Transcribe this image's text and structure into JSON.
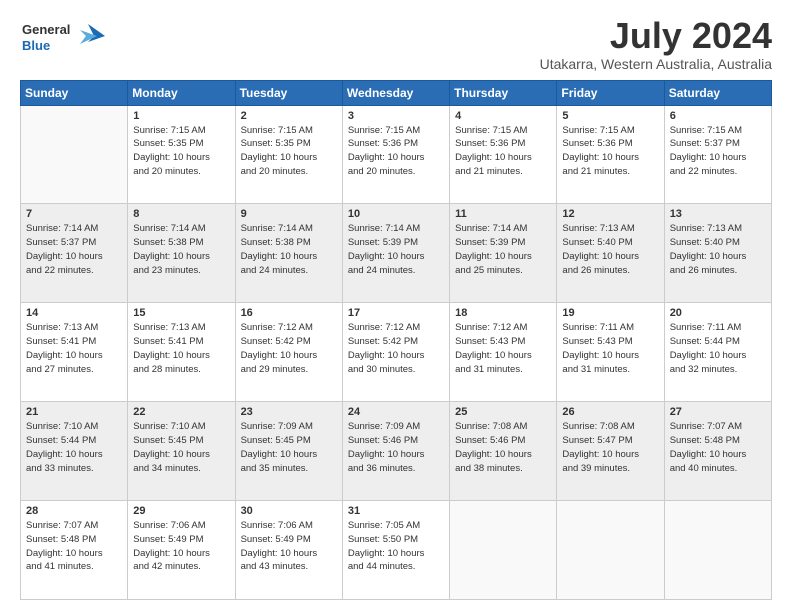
{
  "header": {
    "logo_line1": "General",
    "logo_line2": "Blue",
    "month": "July 2024",
    "location": "Utakarra, Western Australia, Australia"
  },
  "days_of_week": [
    "Sunday",
    "Monday",
    "Tuesday",
    "Wednesday",
    "Thursday",
    "Friday",
    "Saturday"
  ],
  "weeks": [
    [
      {
        "day": "",
        "content": ""
      },
      {
        "day": "1",
        "content": "Sunrise: 7:15 AM\nSunset: 5:35 PM\nDaylight: 10 hours\nand 20 minutes."
      },
      {
        "day": "2",
        "content": "Sunrise: 7:15 AM\nSunset: 5:35 PM\nDaylight: 10 hours\nand 20 minutes."
      },
      {
        "day": "3",
        "content": "Sunrise: 7:15 AM\nSunset: 5:36 PM\nDaylight: 10 hours\nand 20 minutes."
      },
      {
        "day": "4",
        "content": "Sunrise: 7:15 AM\nSunset: 5:36 PM\nDaylight: 10 hours\nand 21 minutes."
      },
      {
        "day": "5",
        "content": "Sunrise: 7:15 AM\nSunset: 5:36 PM\nDaylight: 10 hours\nand 21 minutes."
      },
      {
        "day": "6",
        "content": "Sunrise: 7:15 AM\nSunset: 5:37 PM\nDaylight: 10 hours\nand 22 minutes."
      }
    ],
    [
      {
        "day": "7",
        "content": "Sunrise: 7:14 AM\nSunset: 5:37 PM\nDaylight: 10 hours\nand 22 minutes."
      },
      {
        "day": "8",
        "content": "Sunrise: 7:14 AM\nSunset: 5:38 PM\nDaylight: 10 hours\nand 23 minutes."
      },
      {
        "day": "9",
        "content": "Sunrise: 7:14 AM\nSunset: 5:38 PM\nDaylight: 10 hours\nand 24 minutes."
      },
      {
        "day": "10",
        "content": "Sunrise: 7:14 AM\nSunset: 5:39 PM\nDaylight: 10 hours\nand 24 minutes."
      },
      {
        "day": "11",
        "content": "Sunrise: 7:14 AM\nSunset: 5:39 PM\nDaylight: 10 hours\nand 25 minutes."
      },
      {
        "day": "12",
        "content": "Sunrise: 7:13 AM\nSunset: 5:40 PM\nDaylight: 10 hours\nand 26 minutes."
      },
      {
        "day": "13",
        "content": "Sunrise: 7:13 AM\nSunset: 5:40 PM\nDaylight: 10 hours\nand 26 minutes."
      }
    ],
    [
      {
        "day": "14",
        "content": "Sunrise: 7:13 AM\nSunset: 5:41 PM\nDaylight: 10 hours\nand 27 minutes."
      },
      {
        "day": "15",
        "content": "Sunrise: 7:13 AM\nSunset: 5:41 PM\nDaylight: 10 hours\nand 28 minutes."
      },
      {
        "day": "16",
        "content": "Sunrise: 7:12 AM\nSunset: 5:42 PM\nDaylight: 10 hours\nand 29 minutes."
      },
      {
        "day": "17",
        "content": "Sunrise: 7:12 AM\nSunset: 5:42 PM\nDaylight: 10 hours\nand 30 minutes."
      },
      {
        "day": "18",
        "content": "Sunrise: 7:12 AM\nSunset: 5:43 PM\nDaylight: 10 hours\nand 31 minutes."
      },
      {
        "day": "19",
        "content": "Sunrise: 7:11 AM\nSunset: 5:43 PM\nDaylight: 10 hours\nand 31 minutes."
      },
      {
        "day": "20",
        "content": "Sunrise: 7:11 AM\nSunset: 5:44 PM\nDaylight: 10 hours\nand 32 minutes."
      }
    ],
    [
      {
        "day": "21",
        "content": "Sunrise: 7:10 AM\nSunset: 5:44 PM\nDaylight: 10 hours\nand 33 minutes."
      },
      {
        "day": "22",
        "content": "Sunrise: 7:10 AM\nSunset: 5:45 PM\nDaylight: 10 hours\nand 34 minutes."
      },
      {
        "day": "23",
        "content": "Sunrise: 7:09 AM\nSunset: 5:45 PM\nDaylight: 10 hours\nand 35 minutes."
      },
      {
        "day": "24",
        "content": "Sunrise: 7:09 AM\nSunset: 5:46 PM\nDaylight: 10 hours\nand 36 minutes."
      },
      {
        "day": "25",
        "content": "Sunrise: 7:08 AM\nSunset: 5:46 PM\nDaylight: 10 hours\nand 38 minutes."
      },
      {
        "day": "26",
        "content": "Sunrise: 7:08 AM\nSunset: 5:47 PM\nDaylight: 10 hours\nand 39 minutes."
      },
      {
        "day": "27",
        "content": "Sunrise: 7:07 AM\nSunset: 5:48 PM\nDaylight: 10 hours\nand 40 minutes."
      }
    ],
    [
      {
        "day": "28",
        "content": "Sunrise: 7:07 AM\nSunset: 5:48 PM\nDaylight: 10 hours\nand 41 minutes."
      },
      {
        "day": "29",
        "content": "Sunrise: 7:06 AM\nSunset: 5:49 PM\nDaylight: 10 hours\nand 42 minutes."
      },
      {
        "day": "30",
        "content": "Sunrise: 7:06 AM\nSunset: 5:49 PM\nDaylight: 10 hours\nand 43 minutes."
      },
      {
        "day": "31",
        "content": "Sunrise: 7:05 AM\nSunset: 5:50 PM\nDaylight: 10 hours\nand 44 minutes."
      },
      {
        "day": "",
        "content": ""
      },
      {
        "day": "",
        "content": ""
      },
      {
        "day": "",
        "content": ""
      }
    ]
  ]
}
